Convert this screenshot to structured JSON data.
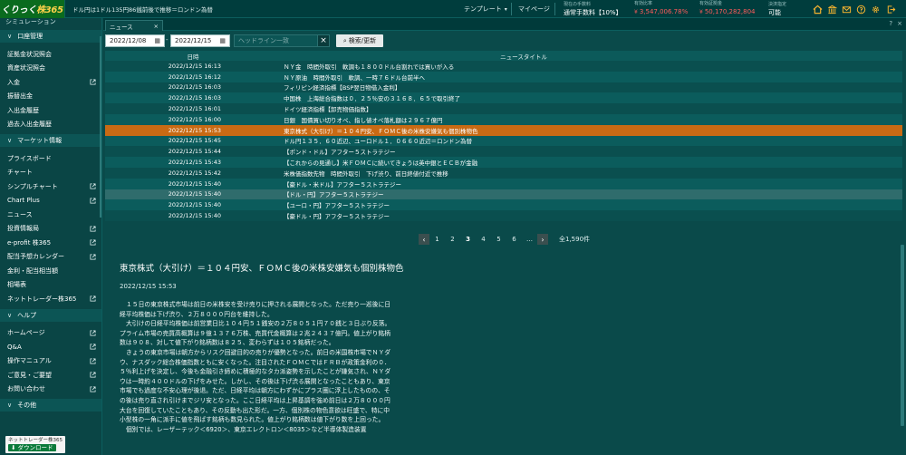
{
  "header": {
    "logo_prefix": "くりっく",
    "logo_main": "株365",
    "ticker": "ドル円は1ドル135円86銭前後で推移＝ロンドン為替",
    "template_label": "テンプレート",
    "mypage_label": "マイページ",
    "stats": [
      {
        "label": "現在の手数料",
        "value": "通常手数料【10%】"
      },
      {
        "label": "有効比率",
        "value": "3,547,006.78%"
      },
      {
        "label": "有効証拠金",
        "value": "50,170,282,804"
      },
      {
        "label": "決済指定",
        "value": "可能"
      }
    ]
  },
  "sidebar": {
    "top_item": "シミュレーション",
    "sections": [
      {
        "title": "口座管理",
        "items": [
          {
            "label": "証拠金状況照会",
            "ext": false
          },
          {
            "label": "資産状況照会",
            "ext": false
          },
          {
            "label": "入金",
            "ext": true
          },
          {
            "label": "振替出金",
            "ext": false
          },
          {
            "label": "入出金履歴",
            "ext": false
          },
          {
            "label": "過去入出金履歴",
            "ext": false
          }
        ]
      },
      {
        "title": "マーケット情報",
        "items": [
          {
            "label": "プライスボード",
            "ext": false
          },
          {
            "label": "チャート",
            "ext": false
          },
          {
            "label": "シンプルチャート",
            "ext": true
          },
          {
            "label": "Chart Plus",
            "ext": true
          },
          {
            "label": "ニュース",
            "ext": false
          },
          {
            "label": "投資情報局",
            "ext": true
          },
          {
            "label": "e-profit 株365",
            "ext": true
          },
          {
            "label": "配当予想カレンダー",
            "ext": true
          },
          {
            "label": "金利・配当相当額",
            "ext": false
          },
          {
            "label": "相場表",
            "ext": false
          },
          {
            "label": "ネットトレーダー株365",
            "ext": true
          }
        ]
      },
      {
        "title": "ヘルプ",
        "items": [
          {
            "label": "ホームページ",
            "ext": true
          },
          {
            "label": "Q&A",
            "ext": true
          },
          {
            "label": "操作マニュアル",
            "ext": true
          },
          {
            "label": "ご意見・ご要望",
            "ext": true
          },
          {
            "label": "お問い合わせ",
            "ext": true
          }
        ]
      },
      {
        "title": "その他",
        "items": []
      }
    ],
    "download_line1": "ネットトレーダー株365",
    "download_line2": "ダウンロード"
  },
  "news": {
    "tab_label": "ニュース",
    "date_from": "2022/12/08",
    "date_to": "2022/12/15",
    "date_separator": "-",
    "headline_placeholder": "ヘッドライン一致",
    "search_label": "検索/更新",
    "col_date": "日時",
    "col_title": "ニュースタイトル",
    "rows": [
      {
        "date": "2022/12/15 16:13",
        "title": "ＮＹ金　時間外取引　軟調も１８００ドル台割れでは買いが入る"
      },
      {
        "date": "2022/12/15 16:12",
        "title": "ＮＹ原油　時間外取引　軟調、一時７６ドル台前半へ"
      },
      {
        "date": "2022/12/15 16:03",
        "title": "フィリピン経済指標【BSP翌日物借入金利】"
      },
      {
        "date": "2022/12/15 16:03",
        "title": "中国株　上海総合指数は０．２５％安の３１６８．６５で取引終了"
      },
      {
        "date": "2022/12/15 16:01",
        "title": "ドイツ経済指標【卸売物価指数】"
      },
      {
        "date": "2022/12/15 16:00",
        "title": "日銀　国債買い切りオペ、指し値オペ落札額は２９６７億円"
      },
      {
        "date": "2022/12/15 15:53",
        "title": "東京株式（大引け）＝１０４円安、ＦＯＭＣ後の米株安嫌気も個別株物色"
      },
      {
        "date": "2022/12/15 15:45",
        "title": "ドル円１３５．６０近辺、ユーロドル１．０６６０近辺＝ロンドン為替"
      },
      {
        "date": "2022/12/15 15:44",
        "title": "【ポンド・ドル】アフター５ストラテジー"
      },
      {
        "date": "2022/12/15 15:43",
        "title": "【これからの見通し】米ＦＯＭＣに続いてきょうは英中銀とＥＣＢが金融"
      },
      {
        "date": "2022/12/15 15:42",
        "title": "米株価指数先物　時間外取引　下げ渋り、前日終値付近で推移"
      },
      {
        "date": "2022/12/15 15:40",
        "title": "【豪ドル・米ドル】アフター５ストラテジー"
      },
      {
        "date": "2022/12/15 15:40",
        "title": "【ドル・円】アフター５ストラテジー"
      },
      {
        "date": "2022/12/15 15:40",
        "title": "【ユーロ・円】アフター５ストラテジー"
      },
      {
        "date": "2022/12/15 15:40",
        "title": "【豪ドル・円】アフター５ストラテジー"
      }
    ],
    "pages": [
      "1",
      "2",
      "3",
      "4",
      "5",
      "6",
      "…"
    ],
    "current_page": "3",
    "total": "全1,590件"
  },
  "article": {
    "title": "東京株式（大引け）＝１０４円安、ＦＯＭＣ後の米株安嫌気も個別株物色",
    "date": "2022/12/15 15:53",
    "paragraphs": [
      "１５日の東京株式市場は前日の米株安を受け売りに押される展開となった。ただ売り一巡後に日経平均株価は下げ渋り、２万８０００円台を維持した。",
      "大引けの日経平均株価は前営業日比１０４円５１銭安の２万８０５１円７０銭と３日ぶり反落。プライム市場の売買高概算は９億１３７６万株、売買代金概算は２兆２４３７億円。値上がり銘柄数は９０８、対して値下がり銘柄数は８２５、変わらずは１０５銘柄だった。",
      "きょうの東京市場は朝方からリスク回避目的の売りが優勢となった。前日の米国株市場でＮＹダウ、ナスダック総合株価指数ともに安くなった。注目されたＦＯＭＣではＦＲＢが政策金利の０．５％利上げを決定し、今後も金融引き締めに積極的なタカ派姿勢を示したことが嫌気され、ＮＹダウは一時約４００ドルの下げをみせた。しかし、その後は下げ渋る展開となったこともあり、東京市場でも過度な不安心理が後退。ただ、日経平均は朝方にわずかにプラス圏に浮上したものの、その後は売り直され引けまでジリ安となった。ここ日経平均は上昇基調を強め前日は２万８０００円大台を回復していたこともあり、その反動も出た形だ。一方、個別株の物色意欲は旺盛で、特に中小型株の一角に派手に値を飛ばす銘柄も数見られた。値上がり銘柄数は値下がり数を上回った。",
      "個別では、レーザーテック＜6920＞、東京エレクトロン＜8035＞など半導体製造装置"
    ]
  }
}
